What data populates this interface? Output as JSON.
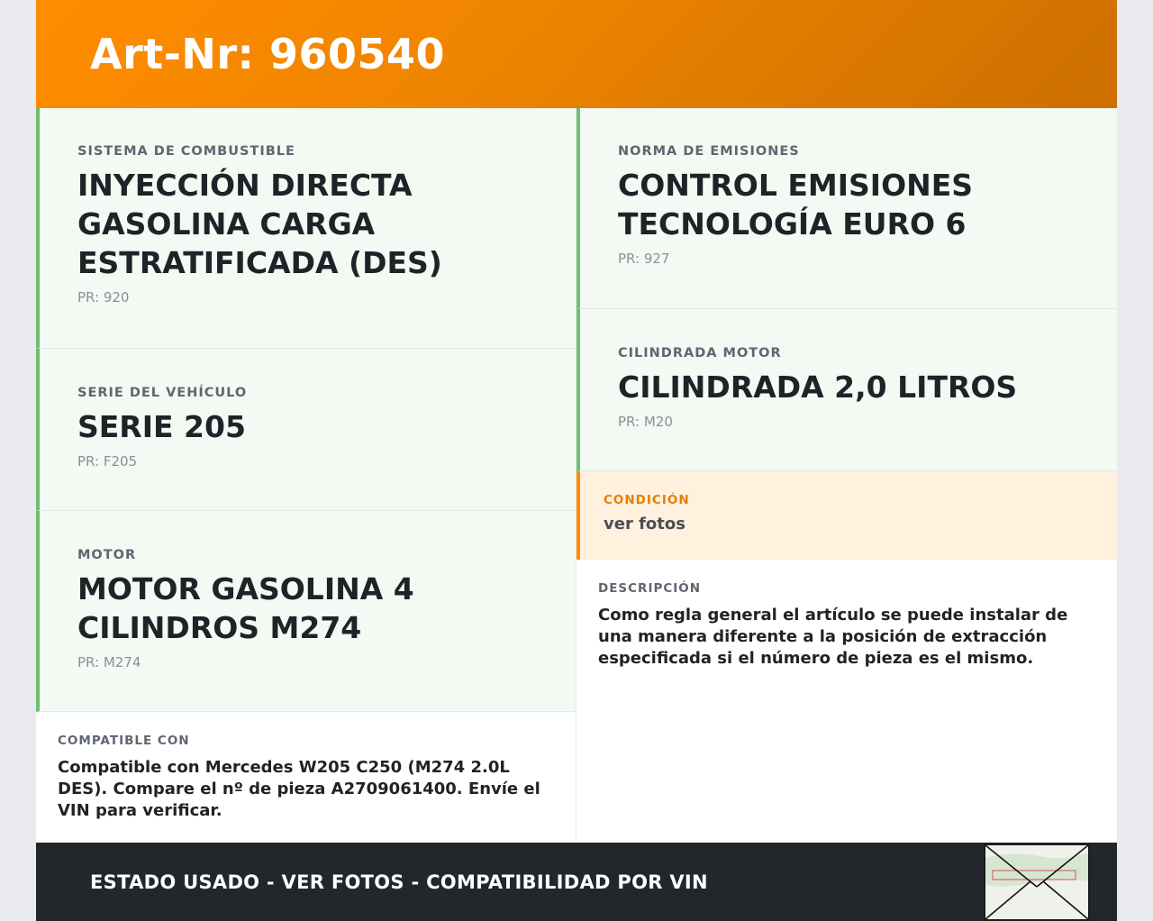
{
  "header": {
    "title": "Art-Nr: 960540"
  },
  "left": {
    "cards": [
      {
        "label": "Sistema de combustible",
        "value": "INYECCIÓN DIRECTA GASOLINA CARGA ESTRATIFICADA (DES)",
        "pr": "PR: 920"
      },
      {
        "label": "Serie del vehículo",
        "value": "SERIE 205",
        "pr": "PR: F205"
      },
      {
        "label": "Motor",
        "value": "MOTOR GASOLINA 4 CILINDROS M274",
        "pr": "PR: M274"
      }
    ],
    "compat": {
      "label": "Compatible con",
      "text": "Compatible con Mercedes W205 C250 (M274 2.0L DES). Compare el nº de pieza A2709061400. Envíe el VIN para verificar."
    }
  },
  "right": {
    "cards": [
      {
        "label": "Norma de emisiones",
        "value": "CONTROL EMISIONES TECNOLOGÍA EURO 6",
        "pr": "PR: 927"
      },
      {
        "label": "Cilindrada motor",
        "value": "CILINDRADA 2,0 LITROS",
        "pr": "PR: M20"
      }
    ],
    "condition": {
      "label": "Condición",
      "text": "ver fotos"
    },
    "description": {
      "label": "Descripción",
      "text": "Como regla general el artículo se puede instalar de una manera diferente a la posición de extracción especificada si el número de pieza es el mismo."
    }
  },
  "footer": {
    "text": "ESTADO USADO - VER FOTOS - COMPATIBILIDAD POR VIN"
  },
  "colors": {
    "accent": "#ff8c00",
    "green": "#6cc070",
    "dark": "#23262b"
  },
  "icons": {
    "thumbnail": "envelope-icon"
  }
}
